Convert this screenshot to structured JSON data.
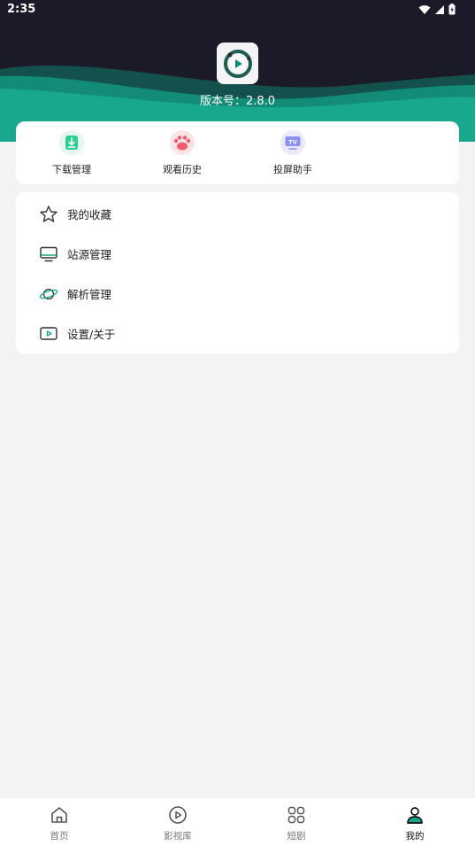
{
  "status_bar": {
    "time": "2:35"
  },
  "profile": {
    "version_text": "版本号：2.8.0"
  },
  "quick_actions": [
    {
      "label": "下载管理",
      "icon": "download-icon",
      "color": "#2ecc8f"
    },
    {
      "label": "观看历史",
      "icon": "paw-icon",
      "color": "#f25d6b"
    },
    {
      "label": "投屏助手",
      "icon": "tv-cast-icon",
      "color": "#8a8ff0"
    }
  ],
  "menu": [
    {
      "label": "我的收藏",
      "icon": "star-icon"
    },
    {
      "label": "站源管理",
      "icon": "monitor-icon"
    },
    {
      "label": "解析管理",
      "icon": "planet-icon"
    },
    {
      "label": "设置/关于",
      "icon": "play-screen-icon"
    }
  ],
  "bottom_nav": [
    {
      "label": "首页",
      "icon": "home-icon"
    },
    {
      "label": "影视库",
      "icon": "play-circle-icon"
    },
    {
      "label": "短剧",
      "icon": "grid-icon"
    },
    {
      "label": "我的",
      "icon": "person-icon",
      "active": true
    }
  ],
  "colors": {
    "header_bg": "#1b1a29",
    "accent": "#15a58a",
    "page_bg": "#f2f3f5"
  }
}
